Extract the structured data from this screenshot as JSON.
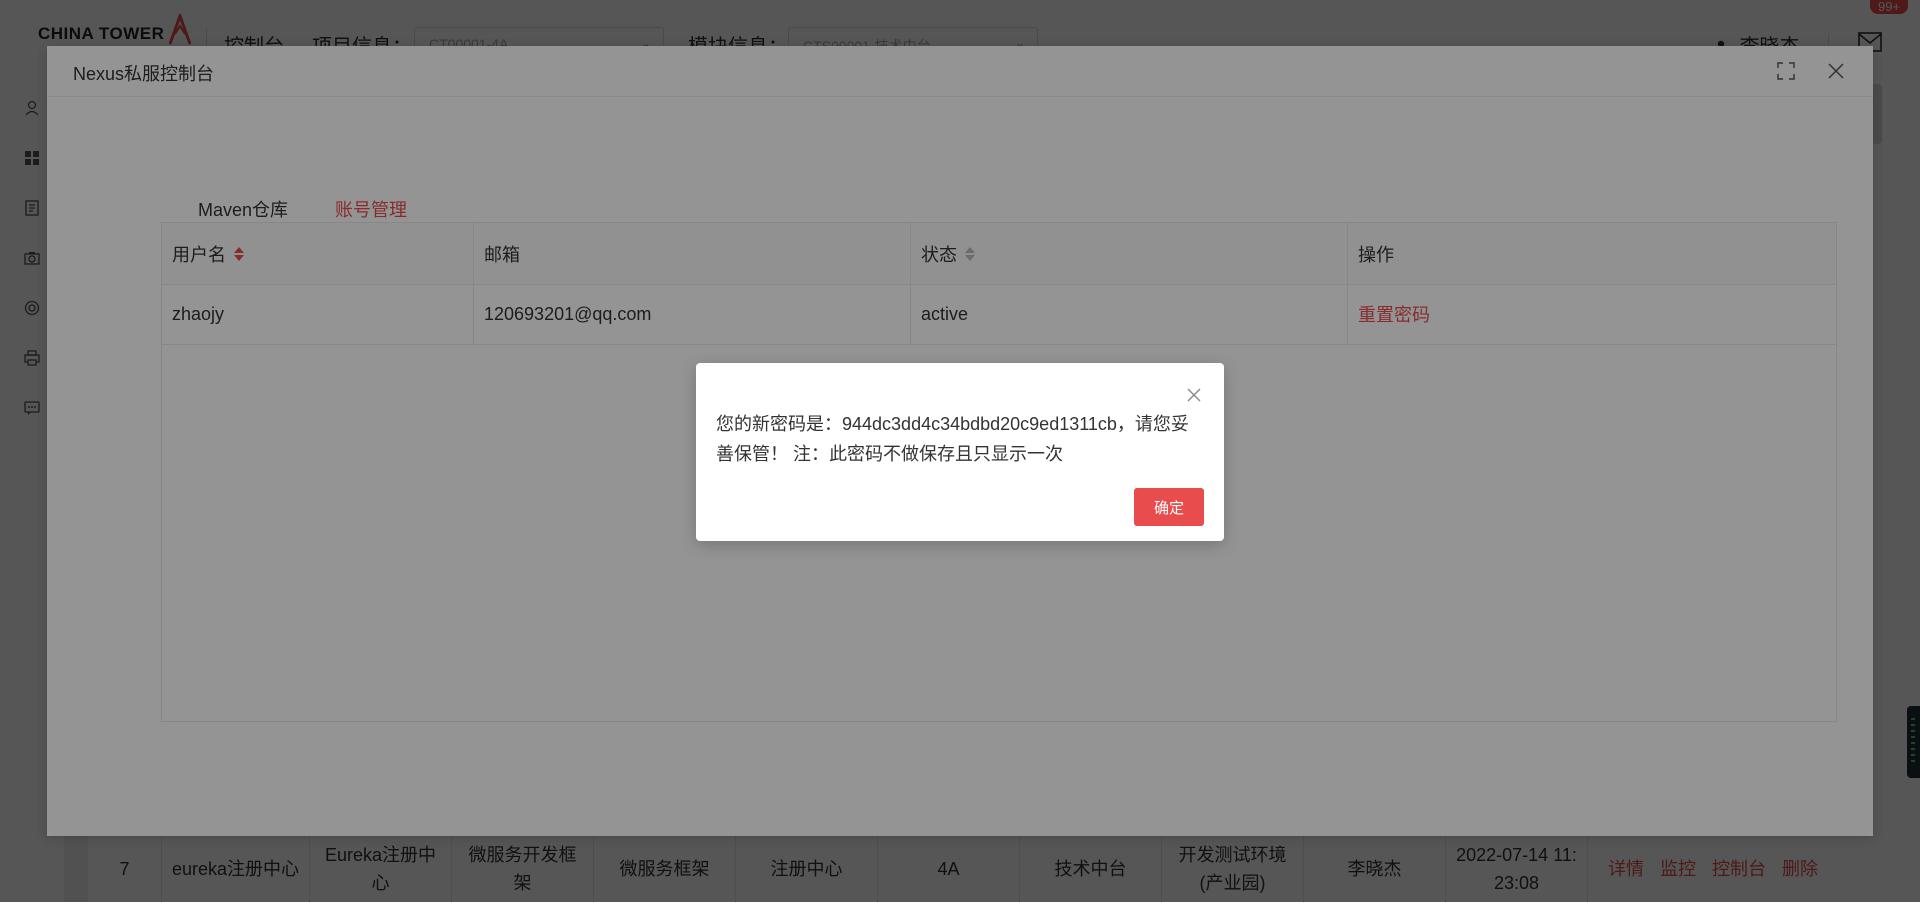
{
  "app": {
    "logo_text": "CHINA TOWER",
    "nav_console": "控制台",
    "project_label": "项目信息：",
    "project_value": "CT00001-4A",
    "module_label": "模块信息：",
    "module_value": "CTS00001-技术中台",
    "user_name": "李晓杰",
    "badge": "99+",
    "sidebar_icons": [
      "user-icon",
      "dashboard-icon",
      "document-icon",
      "camera-icon",
      "target-icon",
      "printer-icon",
      "chat-icon"
    ]
  },
  "bg_table": {
    "row": [
      "7",
      "eureka注册中心",
      "Eureka注册中\n心",
      "微服务开发框\n架",
      "微服务框架",
      "注册中心",
      "4A",
      "技术中台",
      "开发测试环境\n(产业园)",
      "李晓杰",
      "2022-07-14 11:\n23:08"
    ],
    "actions": [
      "详情",
      "监控",
      "控制台",
      "删除"
    ]
  },
  "panel": {
    "title": "Nexus私服控制台",
    "tabs": [
      {
        "label": "Maven仓库",
        "active": false
      },
      {
        "label": "账号管理",
        "active": true
      }
    ],
    "table": {
      "headers": [
        "用户名",
        "邮箱",
        "状态",
        "操作"
      ],
      "rows": [
        {
          "username": "zhaojy",
          "email": "120693201@qq.com",
          "status": "active",
          "action": "重置密码"
        }
      ]
    }
  },
  "dialog": {
    "message": "您的新密码是：944dc3dd4c34bdbd20c9ed1311cb，请您妥善保管！ 注：此密码不做保存且只显示一次",
    "ok_label": "确定"
  },
  "colors": {
    "accent": "#e84c4c"
  }
}
